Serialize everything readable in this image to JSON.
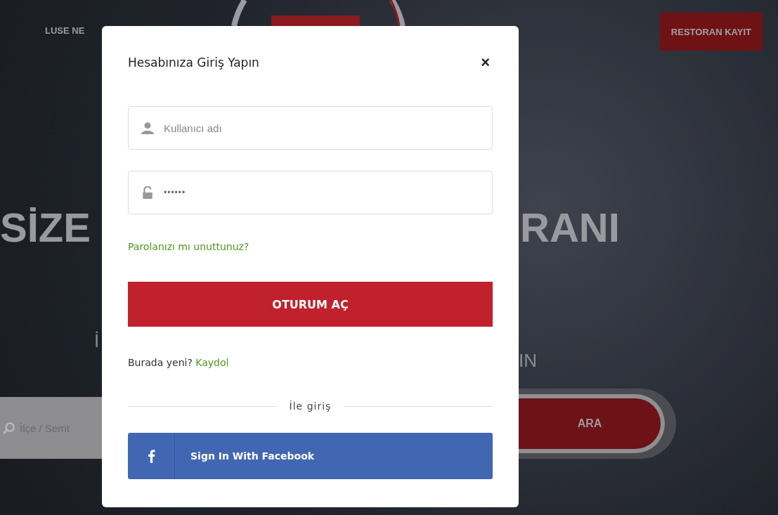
{
  "background": {
    "nav_left": "LUSE NE",
    "nav_button": "RESTORAN KAYIT",
    "headline_left": "SİZE",
    "headline_right": "RANI",
    "subline_left": "İ",
    "subline_right": "IN",
    "search": {
      "placeholder": "İlçe / Semt"
    },
    "search_button": "ARA"
  },
  "modal": {
    "title": "Hesabınıza Giriş Yapın",
    "close": "×",
    "fields": [
      {
        "kind": "user",
        "placeholder": "Kullanıcı adı"
      },
      {
        "kind": "lock",
        "value": "••••••"
      }
    ],
    "forgot_link": "Parolanızı mı unuttunuz?",
    "submit": "OTURUM AÇ",
    "signup_text": "Burada yeni?",
    "signup_link": "Kaydol",
    "divider_text": "İle giriş",
    "facebook_button": "Sign In With Facebook"
  }
}
